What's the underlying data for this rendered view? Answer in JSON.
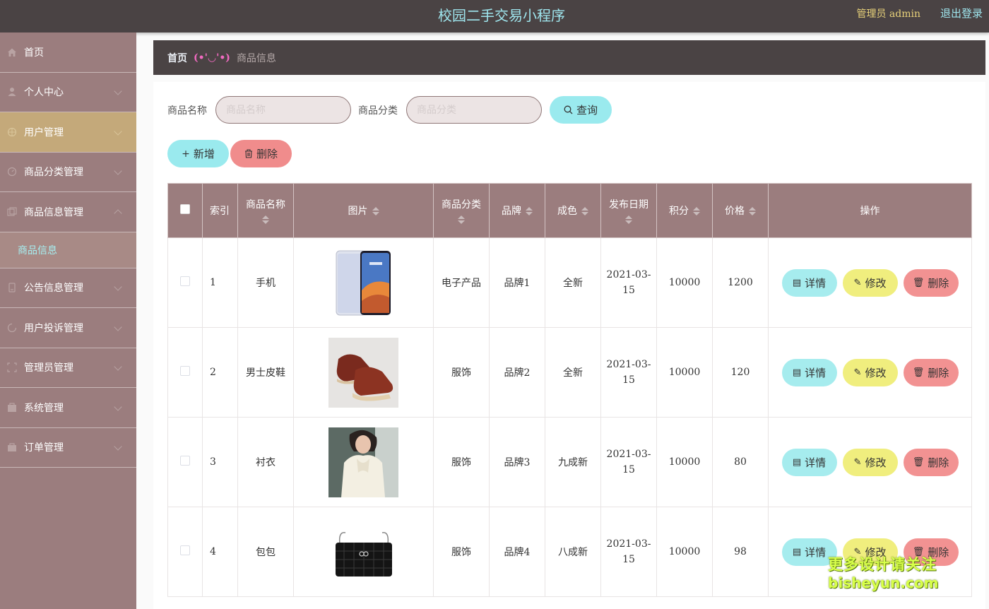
{
  "header": {
    "title": "校园二手交易小程序",
    "admin_label": "管理员 admin",
    "logout_label": "退出登录"
  },
  "sidebar": {
    "items": [
      {
        "label": "首页",
        "icon": "home-icon"
      },
      {
        "label": "个人中心",
        "icon": "user-icon"
      },
      {
        "label": "用户管理",
        "icon": "users-icon"
      },
      {
        "label": "商品分类管理",
        "icon": "category-icon"
      },
      {
        "label": "商品信息管理",
        "icon": "goods-icon"
      },
      {
        "label": "公告信息管理",
        "icon": "notice-icon"
      },
      {
        "label": "用户投诉管理",
        "icon": "complaint-icon"
      },
      {
        "label": "管理员管理",
        "icon": "admin-icon"
      },
      {
        "label": "系统管理",
        "icon": "system-icon"
      },
      {
        "label": "订单管理",
        "icon": "order-icon"
      }
    ],
    "submenu_active": "商品信息"
  },
  "breadcrumb": {
    "home": "首页",
    "separator": "(•'◡'•)",
    "current": "商品信息"
  },
  "search": {
    "name_label": "商品名称",
    "name_placeholder": "商品名称",
    "category_label": "商品分类",
    "category_placeholder": "商品分类",
    "search_button": "查询"
  },
  "actions": {
    "add_label": "新增",
    "delete_label": "删除"
  },
  "table": {
    "headers": {
      "index": "索引",
      "name": "商品名称",
      "image": "图片",
      "category": "商品分类",
      "brand": "品牌",
      "condition": "成色",
      "date": "发布日期",
      "points": "积分",
      "price": "价格",
      "ops": "操作"
    },
    "op_labels": {
      "detail": "详情",
      "edit": "修改",
      "delete": "删除"
    },
    "rows": [
      {
        "index": "1",
        "name": "手机",
        "image": "phone",
        "category": "电子产品",
        "brand": "品牌1",
        "condition": "全新",
        "date": "2021-03-15",
        "points": "10000",
        "price": "1200"
      },
      {
        "index": "2",
        "name": "男士皮鞋",
        "image": "shoes",
        "category": "服饰",
        "brand": "品牌2",
        "condition": "全新",
        "date": "2021-03-15",
        "points": "10000",
        "price": "120"
      },
      {
        "index": "3",
        "name": "衬衣",
        "image": "shirt",
        "category": "服饰",
        "brand": "品牌3",
        "condition": "九成新",
        "date": "2021-03-15",
        "points": "10000",
        "price": "80"
      },
      {
        "index": "4",
        "name": "包包",
        "image": "bag",
        "category": "服饰",
        "brand": "品牌4",
        "condition": "八成新",
        "date": "2021-03-15",
        "points": "10000",
        "price": "98"
      }
    ]
  },
  "watermark": {
    "line1": "更多设计请关注",
    "line2": "bisheyun.com"
  }
}
